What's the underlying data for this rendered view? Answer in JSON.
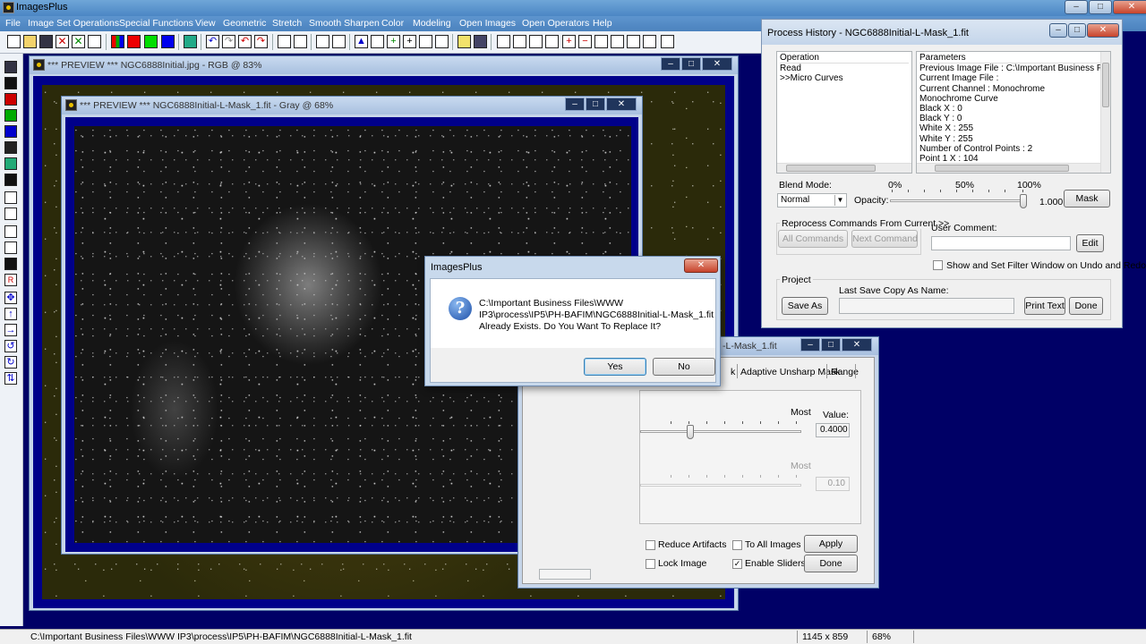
{
  "app": {
    "title": "ImagesPlus",
    "window_buttons": {
      "minimize": "–",
      "maximize": "□",
      "close": "✕"
    }
  },
  "menu": [
    "File",
    "Image Set Operations",
    "Special Functions",
    "View",
    "Geometric",
    "Stretch",
    "Smooth Sharpen",
    "Color",
    "Modeling",
    "Open Images",
    "Open Operators",
    "Help"
  ],
  "preview_rgb": {
    "title": "*** PREVIEW *** NGC6888Initial.jpg - RGB @ 83%"
  },
  "preview_gray": {
    "title": "*** PREVIEW *** NGC6888Initial-L-Mask_1.fit - Gray @ 68%"
  },
  "process_history": {
    "title": "Process History - NGC6888Initial-L-Mask_1.fit",
    "operation_header": "Operation",
    "parameters_header": "Parameters",
    "operations": [
      "Read",
      ">>Micro Curves"
    ],
    "parameters": [
      "Previous Image File : C:\\Important Business Files\\WW",
      "Current Image File :",
      "Current Channel : Monochrome",
      "Monochrome Curve",
      " Black X : 0",
      " Black Y : 0",
      " White X : 255",
      " White Y : 255",
      " Number of Control Points : 2",
      "  Point 1 X : 104"
    ],
    "blend_mode_label": "Blend Mode:",
    "blend_mode_value": "Normal",
    "opacity_label": "Opacity:",
    "opacity_marks": [
      "0%",
      "50%",
      "100%"
    ],
    "opacity_value": "1.000",
    "mask_button": "Mask",
    "reprocess_group": "Reprocess Commands From Current >>",
    "all_commands_button": "All Commands",
    "next_command_button": "Next Command",
    "user_comment_label": "User Comment:",
    "user_comment_value": "",
    "edit_button": "Edit",
    "show_filter_checkbox": "Show and Set Filter Window on Undo and Redo",
    "project_group": "Project",
    "last_save_label": "Last Save Copy As Name:",
    "last_save_value": "",
    "save_as_button": "Save As",
    "print_text_button": "Print Text",
    "done_button": "Done"
  },
  "filter_window": {
    "title": "-L-Mask_1.fit",
    "tabs": [
      "k",
      "Adaptive Unsharp Mask",
      "Range"
    ],
    "slider1_most_label": "Most",
    "value_label": "Value:",
    "slider1_value": "0.4000",
    "slider1_position": 0.62,
    "slider2_most_label": "Most",
    "slider2_value": "0.10",
    "reduce_artifacts_checkbox": "Reduce Artifacts",
    "to_all_images_checkbox": "To All Images",
    "apply_button": "Apply",
    "lock_image_checkbox": "Lock Image",
    "enable_sliders_checkbox": "Enable Sliders",
    "enable_sliders_checked": true,
    "done_button": "Done"
  },
  "dialog": {
    "title": "ImagesPlus",
    "close_button": "✕",
    "message_line1": "C:\\Important Business Files\\WWW",
    "message_line2": "IP3\\process\\IP5\\PH-BAFIM\\NGC6888Initial-L-Mask_1.fit",
    "message_line3": "Already Exists. Do You Want To Replace It?",
    "yes_button": "Yes",
    "no_button": "No"
  },
  "statusbar": {
    "path": "C:\\Important Business Files\\WWW IP3\\process\\IP5\\PH-BAFIM\\NGC6888Initial-L-Mask_1.fit",
    "dimensions": "1145 x 859",
    "zoom": "68%"
  }
}
